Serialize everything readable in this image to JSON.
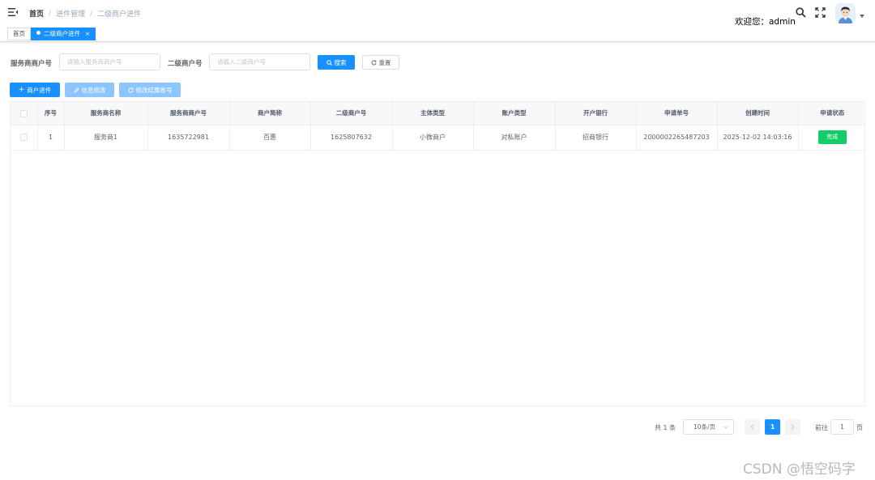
{
  "header": {
    "breadcrumb": [
      "首页",
      "进件管理",
      "二级商户进件"
    ],
    "welcome": "欢迎您：admin"
  },
  "tags": {
    "home": "首页",
    "active": "二级商户进件"
  },
  "filters": {
    "merchant_no_label": "服务商商户号",
    "merchant_no_placeholder": "请输入服务商商户号",
    "sub_no_label": "二级商户号",
    "sub_no_placeholder": "请输入二级商户号",
    "search_label": "搜索",
    "reset_label": "重置"
  },
  "toolbar": {
    "add_label": "商户进件",
    "edit_label": "信息修改",
    "modify_label": "修改结算账号"
  },
  "table": {
    "columns": [
      "序号",
      "服务商名称",
      "服务商商户号",
      "商户简称",
      "二级商户号",
      "主体类型",
      "账户类型",
      "开户银行",
      "申请单号",
      "创建时间",
      "申请状态"
    ],
    "rows": [
      {
        "index": "1",
        "provider_name": "服务商1",
        "provider_no": "1635722981",
        "short_name": "百惠",
        "sub_no": "1625807632",
        "entity_type": "小微商户",
        "account_type": "对私账户",
        "bank": "招商银行",
        "apply_no": "2000002265487203",
        "created": "2025-12-02 14:03:16",
        "status": "完成"
      }
    ]
  },
  "pagination": {
    "total": "共 1 条",
    "page_size": "10条/页",
    "current": "1",
    "goto_label": "前往",
    "goto_value": "1",
    "page_suffix": "页"
  },
  "watermark": "CSDN @悟空码字",
  "colors": {
    "primary": "#1890ff",
    "primary_light": "#8cc5ff",
    "success": "#13ce66"
  }
}
